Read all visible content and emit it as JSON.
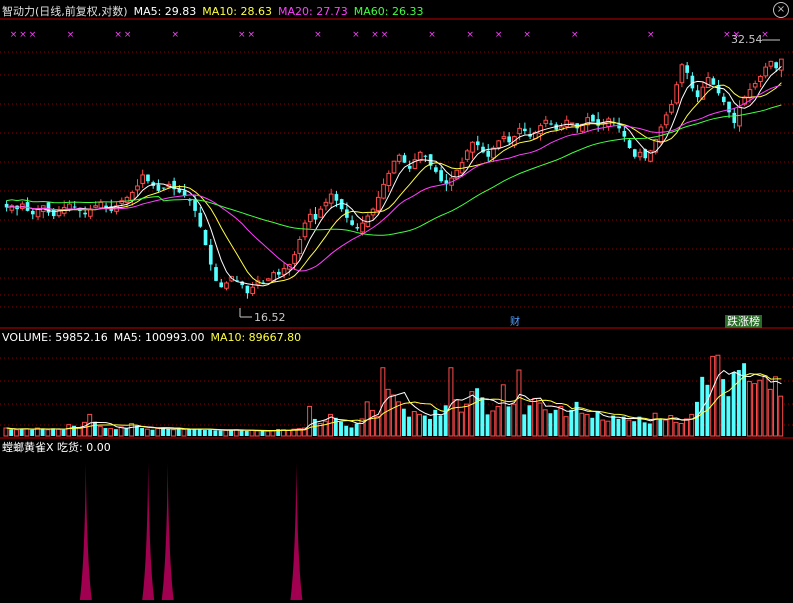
{
  "header": {
    "title": "智动力(日线,前复权,对数)",
    "ma5": "MA5: 29.83",
    "ma10": "MA10: 28.63",
    "ma20": "MA20: 27.73",
    "ma60": "MA60: 26.33",
    "close_symbol": "×"
  },
  "volume_header": {
    "label": "VOLUME: 59852.16",
    "ma5": "MA5: 100993.00",
    "ma10": "MA10: 89667.80"
  },
  "indicator_header": {
    "label": "螳螂黄雀X 吃货: 0.00"
  },
  "annotations": {
    "high_price": "32.54",
    "low_price": "16.52",
    "finance_marker": "财",
    "rank_badge": "跌涨榜"
  },
  "colors": {
    "background": "#000000",
    "up_candle": "#ff4b4b",
    "down_candle": "#54ffff",
    "ma5": "#ffffff",
    "ma10": "#ffff40",
    "ma20": "#ff40ff",
    "ma60": "#40ff40",
    "grid": "#8b0000",
    "signal_x": "#ff40ff",
    "spike": "#a0004f"
  },
  "chart_data": [
    {
      "type": "candlestick",
      "title": "智动力(日线,前复权,对数)",
      "scale": "log",
      "ylim": [
        15.5,
        34.5
      ],
      "lowest_marked": 16.52,
      "highest_marked": 32.54,
      "moving_averages": {
        "MA5": 29.83,
        "MA10": 28.63,
        "MA20": 27.73,
        "MA60": 26.33
      },
      "close": [
        21.0,
        21.1,
        20.9,
        21.2,
        20.8,
        20.6,
        20.9,
        21.1,
        20.7,
        20.5,
        20.8,
        21.0,
        21.2,
        21.0,
        20.8,
        20.6,
        20.9,
        21.1,
        21.3,
        21.0,
        20.8,
        21.1,
        21.4,
        21.6,
        21.9,
        22.3,
        23.0,
        22.6,
        22.3,
        22.0,
        22.2,
        22.4,
        22.1,
        21.9,
        21.7,
        21.4,
        20.8,
        19.9,
        18.9,
        17.9,
        17.1,
        16.8,
        17.0,
        17.3,
        17.1,
        16.9,
        16.52,
        16.8,
        17.1,
        17.0,
        17.2,
        17.5,
        17.4,
        17.7,
        17.9,
        18.4,
        19.2,
        20.1,
        20.6,
        20.3,
        20.9,
        21.3,
        21.8,
        21.4,
        20.9,
        20.4,
        20.0,
        19.8,
        20.1,
        20.5,
        20.9,
        21.6,
        22.4,
        23.1,
        23.9,
        24.3,
        23.8,
        23.4,
        24.0,
        24.5,
        24.2,
        23.6,
        23.2,
        22.6,
        22.4,
        22.8,
        23.3,
        23.8,
        24.6,
        25.2,
        25.0,
        24.5,
        24.2,
        24.8,
        25.3,
        25.6,
        25.2,
        25.6,
        26.2,
        26.0,
        25.6,
        25.9,
        26.4,
        26.8,
        26.5,
        26.1,
        26.3,
        26.8,
        26.6,
        26.2,
        26.5,
        27.0,
        26.7,
        26.4,
        26.6,
        26.9,
        26.6,
        26.2,
        25.6,
        24.8,
        24.2,
        24.5,
        24.1,
        24.6,
        25.4,
        26.3,
        27.2,
        28.0,
        29.6,
        31.3,
        30.6,
        29.3,
        28.6,
        29.4,
        30.2,
        29.6,
        28.9,
        28.2,
        27.4,
        26.6,
        27.8,
        28.6,
        29.2,
        29.7,
        30.3,
        31.1,
        31.6,
        31.0,
        31.8
      ],
      "signals_x": [
        1,
        2,
        3,
        7,
        12,
        13,
        18,
        25,
        26,
        33,
        37,
        39,
        40,
        45,
        49,
        52,
        55,
        60,
        68,
        76,
        77,
        80
      ],
      "legend": [
        "MA5",
        "MA10",
        "MA20",
        "MA60"
      ]
    },
    {
      "type": "bar",
      "title": "VOLUME",
      "series": [
        {
          "name": "VOLUME",
          "value": 59852.16
        },
        {
          "name": "MA5",
          "value": 100993.0
        },
        {
          "name": "MA10",
          "value": 89667.8
        }
      ],
      "ylim": [
        0,
        160000
      ],
      "values": [
        14000,
        12000,
        11000,
        13000,
        12500,
        11000,
        14000,
        12000,
        11000,
        13500,
        12000,
        11000,
        20000,
        18000,
        15000,
        24000,
        38000,
        25000,
        17000,
        14000,
        13000,
        12000,
        16000,
        14000,
        22000,
        18000,
        14000,
        12000,
        11000,
        13000,
        15000,
        12500,
        11000,
        12000,
        11500,
        12000,
        13000,
        12000,
        10500,
        11000,
        10000,
        9500,
        10000,
        10500,
        11000,
        9500,
        9000,
        10000,
        9000,
        9500,
        8500,
        9000,
        12000,
        11000,
        10000,
        12000,
        13000,
        14000,
        52000,
        30000,
        22000,
        26000,
        38000,
        32000,
        25000,
        18000,
        15000,
        22000,
        30000,
        60000,
        45000,
        34000,
        120000,
        82000,
        72000,
        60000,
        48000,
        34000,
        43000,
        38000,
        36000,
        30000,
        46000,
        36000,
        54000,
        120000,
        64000,
        42000,
        56000,
        78000,
        84000,
        68000,
        38000,
        44000,
        52000,
        90000,
        52000,
        56000,
        116000,
        38000,
        54000,
        66000,
        58000,
        46000,
        40000,
        46000,
        52000,
        34000,
        46000,
        60000,
        40000,
        38000,
        32000,
        44000,
        28000,
        26000,
        36000,
        30000,
        34000,
        28000,
        26000,
        34000,
        24000,
        22000,
        40000,
        30000,
        28000,
        36000,
        24000,
        22000,
        30000,
        38000,
        60000,
        104000,
        90000,
        140000,
        142000,
        100000,
        70000,
        112000,
        116000,
        128000,
        96000,
        92000,
        98000,
        106000,
        82000,
        104000,
        70000
      ],
      "up": [
        true,
        false,
        true,
        false,
        true,
        false,
        true,
        false,
        true,
        false,
        true,
        false,
        true,
        false,
        true,
        true,
        true,
        false,
        true,
        false,
        true,
        false,
        true,
        false,
        true,
        false,
        false,
        true,
        false,
        true,
        false,
        false,
        true,
        false,
        true,
        false,
        false,
        false,
        false,
        false,
        false,
        false,
        true,
        false,
        true,
        false,
        false,
        true,
        true,
        false,
        true,
        true,
        false,
        true,
        true,
        true,
        true,
        true,
        true,
        false,
        true,
        true,
        true,
        false,
        false,
        false,
        false,
        false,
        true,
        true,
        true,
        true,
        true,
        true,
        true,
        true,
        false,
        false,
        true,
        true,
        false,
        false,
        false,
        false,
        false,
        true,
        true,
        true,
        true,
        true,
        false,
        false,
        false,
        true,
        true,
        true,
        false,
        true,
        true,
        false,
        false,
        true,
        true,
        true,
        false,
        false,
        true,
        true,
        false,
        false,
        true,
        true,
        false,
        false,
        true,
        true,
        false,
        false,
        false,
        true,
        false,
        false,
        false,
        false,
        true,
        false,
        true,
        true,
        true,
        true,
        true,
        true,
        false,
        false,
        false,
        true,
        true,
        false,
        false,
        false,
        false,
        false,
        true,
        true,
        true,
        true,
        true,
        true,
        true,
        false,
        true
      ]
    },
    {
      "type": "bar",
      "title": "螳螂黄雀X",
      "series": [
        {
          "name": "吃货",
          "value": 0.0
        }
      ],
      "spike_positions": [
        0.06,
        0.14,
        0.165,
        0.33
      ],
      "ylim": [
        0,
        1
      ],
      "values": [
        1,
        1,
        1,
        1
      ]
    }
  ]
}
